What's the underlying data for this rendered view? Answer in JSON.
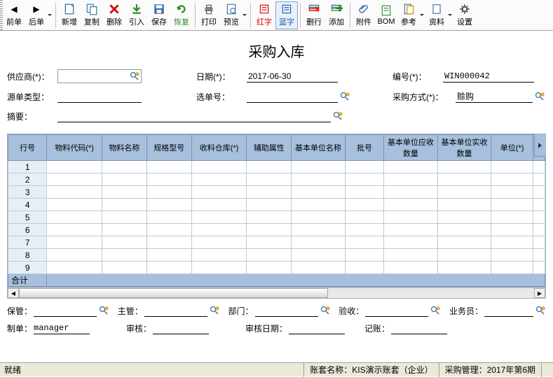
{
  "toolbar": {
    "prev": "前单",
    "next": "后单",
    "new": "新增",
    "copy": "复制",
    "delete": "删除",
    "import": "引入",
    "save": "保存",
    "restore": "恢复",
    "print": "打印",
    "preview": "预览",
    "red": "红字",
    "blue": "蓝字",
    "del2": "删行",
    "add": "添加",
    "attach": "附件",
    "bom": "BOM",
    "ref": "参考",
    "material": "资料",
    "settings": "设置"
  },
  "title": "采购入库",
  "form": {
    "supplier_label": "供应商(*)：",
    "date_label": "日期(*)：",
    "date_value": "2017-06-30",
    "code_label": "编号(*)：",
    "code_value": "WIN000042",
    "srctype_label": "源单类型：",
    "selorder_label": "选单号：",
    "purchmode_label": "采购方式(*)：",
    "purchmode_value": "赊购",
    "summary_label": "摘要："
  },
  "grid": {
    "columns": [
      "行号",
      "物料代码(*)",
      "物料名称",
      "规格型号",
      "收料仓库(*)",
      "辅助属性",
      "基本单位名称",
      "批号",
      "基本单位应收数量",
      "基本单位实收数量",
      "单位(*)"
    ],
    "rows": [
      "1",
      "2",
      "3",
      "4",
      "5",
      "6",
      "7",
      "8",
      "9"
    ],
    "total_label": "合计"
  },
  "footer": {
    "keeper_label": "保管：",
    "supervisor_label": "主管：",
    "dept_label": "部门：",
    "accept_label": "验收：",
    "clerk_label": "业务员：",
    "maker_label": "制单：",
    "maker_value": "manager",
    "audit_label": "审核：",
    "auditdate_label": "审核日期：",
    "book_label": "记账："
  },
  "status": {
    "ready": "就绪",
    "account": "账套名称：KIS演示账套（企业）",
    "period": "采购管理：2017年第6期"
  }
}
